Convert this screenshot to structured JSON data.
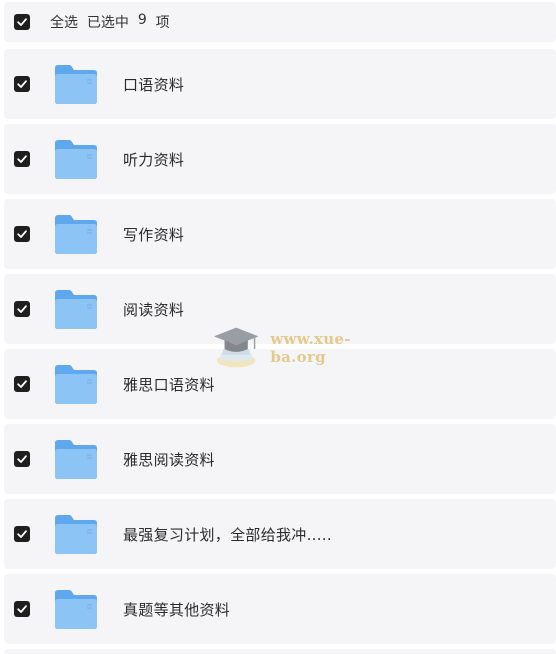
{
  "header": {
    "select_all_label": "全选",
    "selected_prefix": "已选中",
    "selected_count": "9",
    "selected_suffix": "项",
    "checked": true
  },
  "folders": [
    {
      "label": "口语资料",
      "checked": true
    },
    {
      "label": "听力资料",
      "checked": true
    },
    {
      "label": "写作资料",
      "checked": true
    },
    {
      "label": "阅读资料",
      "checked": true
    },
    {
      "label": "雅思口语资料",
      "checked": true
    },
    {
      "label": "雅思阅读资料",
      "checked": true
    },
    {
      "label": "最强复习计划，全部给我冲.....",
      "checked": true
    },
    {
      "label": "真题等其他资料",
      "checked": true
    }
  ],
  "watermark": {
    "text": "www.xue-ba.org",
    "icon": "graduation-cap-icon"
  },
  "colors": {
    "row_background": "#f5f5f7",
    "checkbox": "#1f1f1f",
    "folder_front": "#8cc4f6",
    "folder_back": "#5fa8ee",
    "watermark_text": "#e2c27a"
  }
}
